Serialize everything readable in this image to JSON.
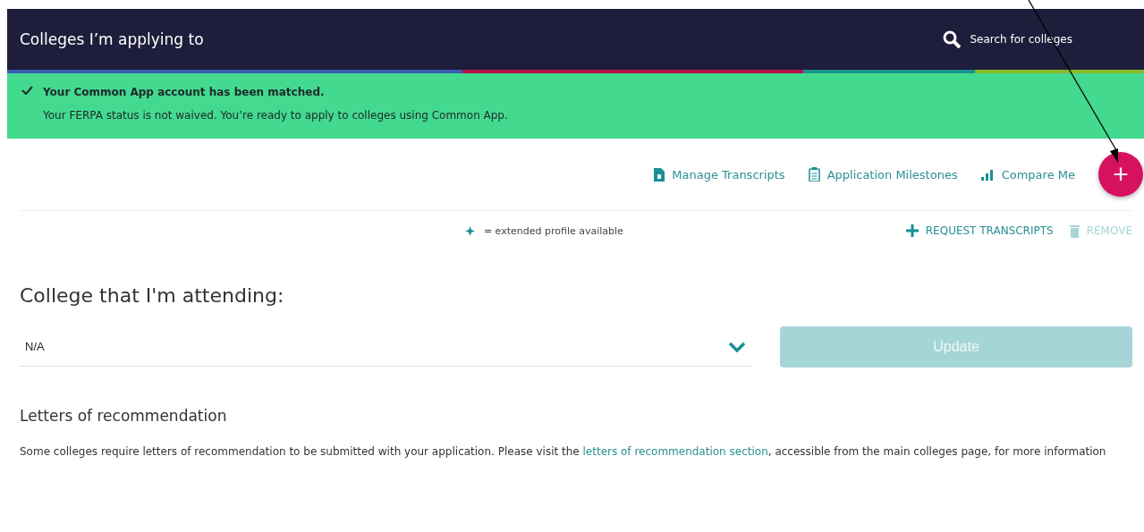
{
  "header": {
    "title": "Colleges I’m applying to",
    "search": "Search for colleges"
  },
  "color_bar": [
    {
      "color": "#3b5bb5"
    },
    {
      "color": "#b5124d"
    },
    {
      "color": "#17948f"
    },
    {
      "color": "#8ab82a"
    }
  ],
  "banner": {
    "title": "Your Common App account has been matched.",
    "message": "Your FERPA status is not waived. You’re ready to apply to colleges using Common App."
  },
  "toolbar": [
    {
      "kind": "transcript",
      "label": "Manage Transcripts"
    },
    {
      "kind": "milestones",
      "label": "Application Milestones"
    },
    {
      "kind": "compare",
      "label": "Compare Me"
    }
  ],
  "add_button": {
    "label": "+"
  },
  "legend": "= extended profile available",
  "actions": [
    {
      "kind": "request",
      "label": "REQUEST TRANSCRIPTS",
      "disabled": false
    },
    {
      "kind": "remove",
      "label": "REMOVE",
      "disabled": true
    }
  ],
  "attending": {
    "heading": "College that I'm attending:",
    "value": "N/A",
    "button": {
      "label": "Update",
      "disabled": true
    }
  },
  "letters": {
    "heading": "Letters of recommendation",
    "before": "Some colleges require letters of recommendation to be submitted with your application. Please visit the ",
    "link": "letters of recommendation section",
    "after": ", accessible from the main colleges page, for more information"
  },
  "annotation": {
    "kind": "arrow"
  }
}
